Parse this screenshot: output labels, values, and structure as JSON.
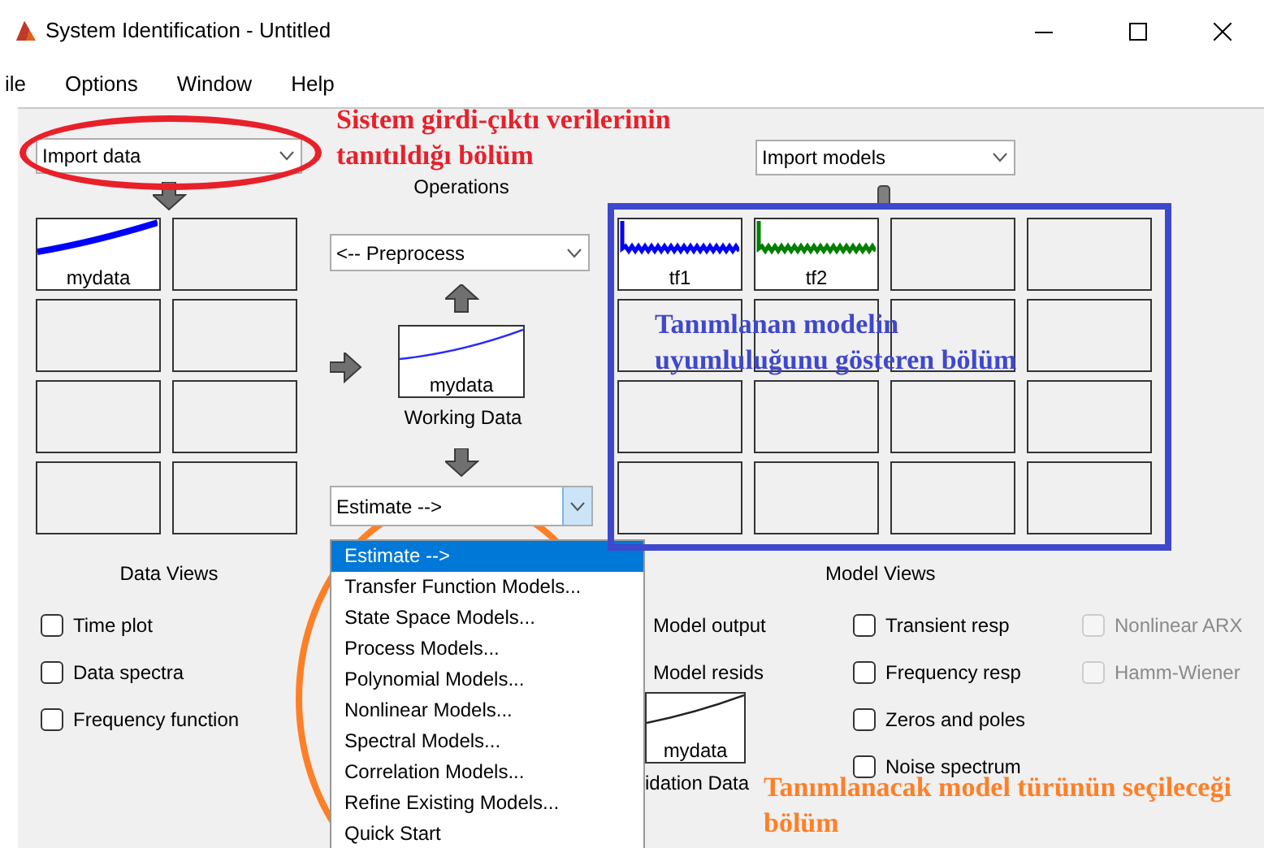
{
  "window": {
    "title": "System Identification - Untitled"
  },
  "menu": [
    "ile",
    "Options",
    "Window",
    "Help"
  ],
  "import_data": {
    "value": "Import data"
  },
  "operations_label": "Operations",
  "preprocess": {
    "value": "<-- Preprocess"
  },
  "working_data": {
    "name": "mydata",
    "label": "Working Data"
  },
  "estimate": {
    "value": "Estimate -->",
    "open": true,
    "options": [
      {
        "label": "Estimate -->",
        "selected": true
      },
      {
        "label": "Transfer Function Models...",
        "selected": false
      },
      {
        "label": "State Space Models...",
        "selected": false
      },
      {
        "label": "Process Models...",
        "selected": false
      },
      {
        "label": "Polynomial Models...",
        "selected": false
      },
      {
        "label": "Nonlinear Models...",
        "selected": false
      },
      {
        "label": "Spectral Models...",
        "selected": false
      },
      {
        "label": "Correlation Models...",
        "selected": false
      },
      {
        "label": "Refine Existing Models...",
        "selected": false
      },
      {
        "label": "Quick Start",
        "selected": false
      }
    ]
  },
  "data_views": {
    "title": "Data Views",
    "slots": [
      {
        "kind": "data",
        "name": "mydata",
        "color": "#0000ff"
      },
      {
        "kind": "empty"
      },
      {
        "kind": "empty"
      },
      {
        "kind": "empty"
      },
      {
        "kind": "empty"
      },
      {
        "kind": "empty"
      },
      {
        "kind": "empty"
      },
      {
        "kind": "empty"
      }
    ],
    "options": [
      {
        "label": "Time plot",
        "checked": false,
        "disabled": false
      },
      {
        "label": "Data spectra",
        "checked": false,
        "disabled": false
      },
      {
        "label": "Frequency function",
        "checked": false,
        "disabled": false
      }
    ]
  },
  "import_models": {
    "value": "Import models"
  },
  "model_views": {
    "title": "Model Views",
    "slots": [
      {
        "kind": "model",
        "name": "tf1",
        "color": "#0000ff"
      },
      {
        "kind": "model",
        "name": "tf2",
        "color": "#008000"
      },
      {
        "kind": "empty"
      },
      {
        "kind": "empty"
      },
      {
        "kind": "empty"
      },
      {
        "kind": "empty"
      },
      {
        "kind": "empty"
      },
      {
        "kind": "empty"
      },
      {
        "kind": "empty"
      },
      {
        "kind": "empty"
      },
      {
        "kind": "empty"
      },
      {
        "kind": "empty"
      },
      {
        "kind": "empty"
      },
      {
        "kind": "empty"
      },
      {
        "kind": "empty"
      },
      {
        "kind": "empty"
      }
    ],
    "outputs": [
      "Model output",
      "Model resids"
    ],
    "responses": [
      {
        "label": "Transient resp",
        "checked": false,
        "disabled": false
      },
      {
        "label": "Frequency resp",
        "checked": false,
        "disabled": false
      },
      {
        "label": "Zeros and poles",
        "checked": false,
        "disabled": false
      },
      {
        "label": "Noise spectrum",
        "checked": false,
        "disabled": false
      }
    ],
    "nonlinear": [
      {
        "label": "Nonlinear ARX",
        "checked": false,
        "disabled": true
      },
      {
        "label": "Hamm-Wiener",
        "checked": false,
        "disabled": true
      }
    ]
  },
  "validation_data": {
    "name": "mydata",
    "label": "idation Data"
  },
  "annotations": [
    {
      "kind": "ellipse",
      "color": "#e8202a",
      "lines": [
        "Sistem girdi-çıktı verilerinin",
        "tanıtıldığı bölüm"
      ]
    },
    {
      "kind": "rectangle",
      "color": "#3f48cc",
      "lines": [
        "Tanımlanan modelin",
        "uyumluluğunu gösteren bölüm"
      ]
    },
    {
      "kind": "ellipse",
      "color": "#ff7f27",
      "lines": [
        "Tanımlanacak model türünün seçileceği",
        "bölüm"
      ]
    }
  ]
}
